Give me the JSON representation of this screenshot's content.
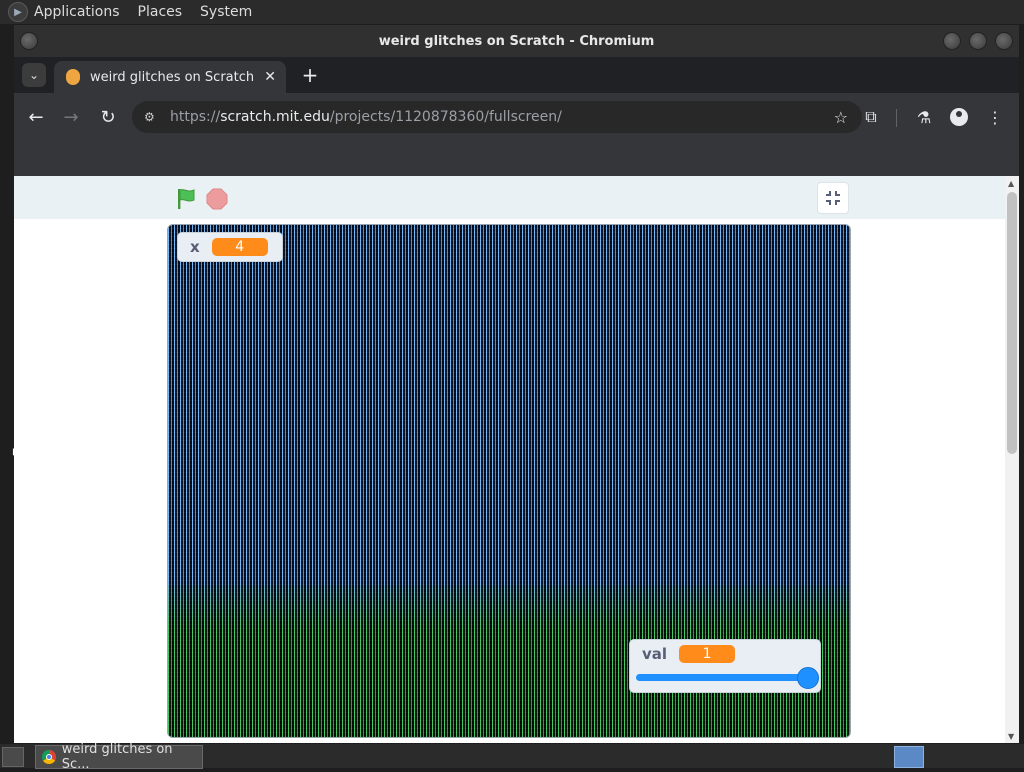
{
  "system_panel": {
    "menus": [
      "Applications",
      "Places",
      "System"
    ]
  },
  "window": {
    "title": "weird glitches on Scratch - Chromium"
  },
  "tabs": [
    {
      "label": "weird glitches on Scratch",
      "active": true
    }
  ],
  "toolbar": {
    "url_prefix": "https://",
    "url_host": "scratch.mit.edu",
    "url_path": "/projects/1120878360/fullscreen/"
  },
  "scratch": {
    "monitor_x": {
      "label": "x",
      "value": "4"
    },
    "monitor_val": {
      "label": "val",
      "value": "1",
      "slider_level": 1.0
    }
  },
  "taskbar": {
    "window_button": "weird glitches on Sc..."
  },
  "colors": {
    "monitor_value": "#ff8c1a",
    "slider": "#1e90ff",
    "header_bg": "#e9f1f5"
  }
}
